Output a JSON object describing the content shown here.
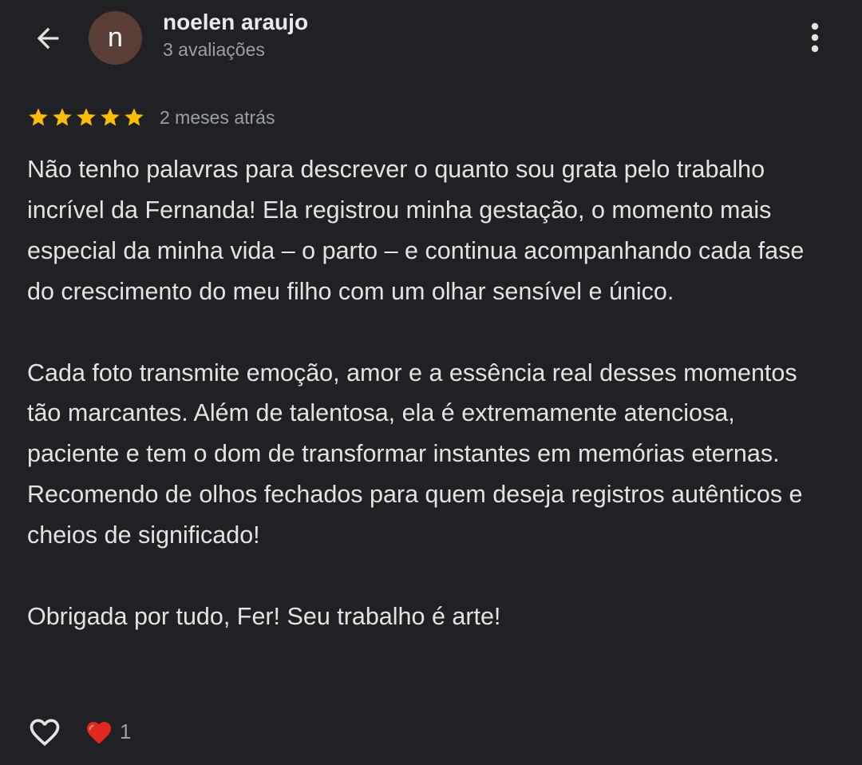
{
  "header": {
    "back_icon": "arrow-back-icon",
    "avatar_letter": "n",
    "avatar_color": "#5a3e36",
    "author_name": "noelen araujo",
    "author_reviews": "3 avaliações",
    "more_icon": "more-vert-icon"
  },
  "rating": {
    "stars": 5,
    "max_stars": 5,
    "star_color": "#fbbc04",
    "date": "2 meses atrás"
  },
  "review": {
    "paragraphs": [
      "Não tenho palavras para descrever o quanto sou grata pelo trabalho incrível da Fernanda! Ela registrou minha gestação, o momento mais especial da minha vida – o parto – e continua acompanhando cada fase do crescimento do meu filho com um olhar sensível e único.",
      "Cada foto transmite emoção, amor e a essência real desses momentos tão marcantes. Além de talentosa, ela é extremamente atenciosa, paciente e tem o dom de transformar instantes em memórias eternas. Recomendo de olhos fechados para quem deseja registros autênticos e cheios de significado!",
      "Obrigada por tudo, Fer! Seu trabalho é arte!"
    ]
  },
  "footer": {
    "like_icon": "heart-outline-icon",
    "reaction_icon": "red-heart-icon",
    "reaction_count": "1"
  }
}
